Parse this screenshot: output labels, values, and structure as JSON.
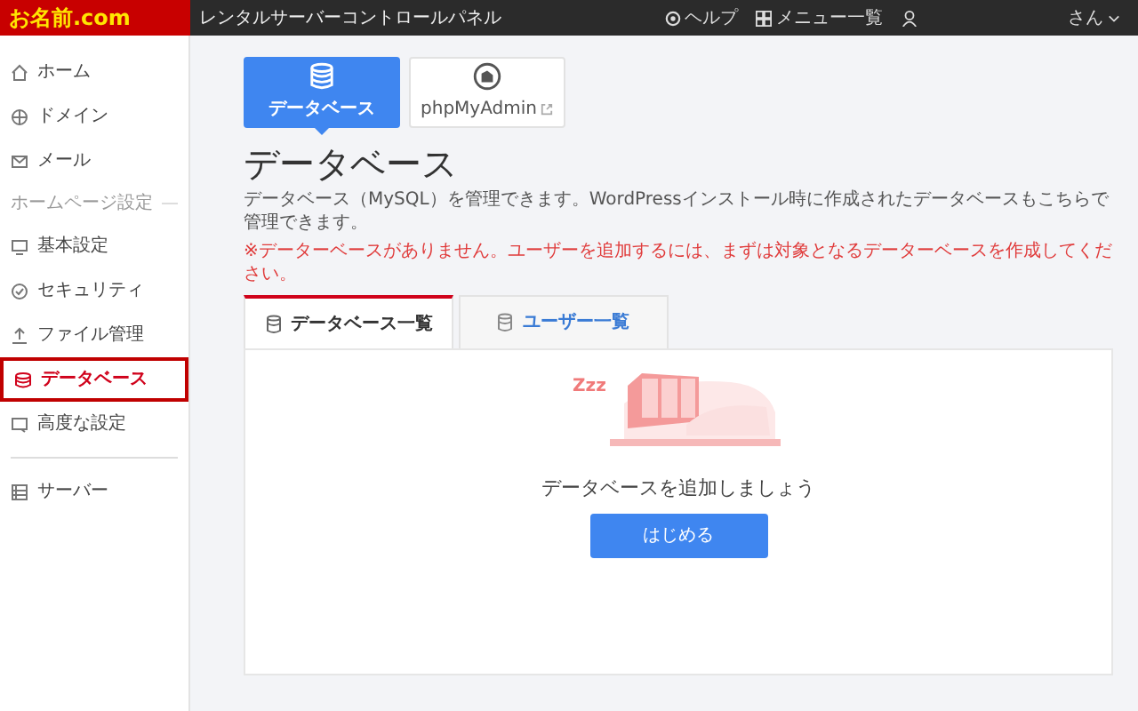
{
  "header": {
    "logo": "お名前.com",
    "title": "レンタルサーバーコントロールパネル",
    "links": [
      {
        "label": "ヘルプ"
      },
      {
        "label": "メニュー一覧"
      }
    ],
    "user": {
      "suffix": "さん"
    }
  },
  "sidebar": {
    "items": [
      {
        "kind": "item",
        "label": "ホーム",
        "selected": false
      },
      {
        "kind": "item",
        "label": "ドメイン",
        "selected": false
      },
      {
        "kind": "item",
        "label": "メール",
        "selected": false
      },
      {
        "kind": "section",
        "label": "ホームページ設定"
      },
      {
        "kind": "item",
        "label": "基本設定",
        "selected": false
      },
      {
        "kind": "item",
        "label": "セキュリティ",
        "selected": false
      },
      {
        "kind": "item",
        "label": "ファイル管理",
        "selected": false
      },
      {
        "kind": "item",
        "label": "データベース",
        "selected": true
      },
      {
        "kind": "item",
        "label": "高度な設定",
        "selected": false
      },
      {
        "kind": "divider"
      },
      {
        "kind": "item",
        "label": "サーバー",
        "selected": false
      }
    ]
  },
  "tiles": [
    {
      "label": "データベース",
      "selected": true,
      "external": false
    },
    {
      "label": "phpMyAdmin",
      "selected": false,
      "external": true
    }
  ],
  "page": {
    "title": "データベース",
    "description": "データベース（MySQL）を管理できます。WordPressインストール時に作成されたデータベースもこちらで管理できます。",
    "warning": "※データーベースがありません。ユーザーを追加するには、まずは対象となるデーターベースを作成してください。"
  },
  "tabs": [
    {
      "label": "データベース一覧",
      "selected": true
    },
    {
      "label": "ユーザー一覧",
      "selected": false
    }
  ],
  "empty": {
    "sleep_mark": "Zzz",
    "message": "データベースを追加しましょう",
    "button": "はじめる"
  }
}
